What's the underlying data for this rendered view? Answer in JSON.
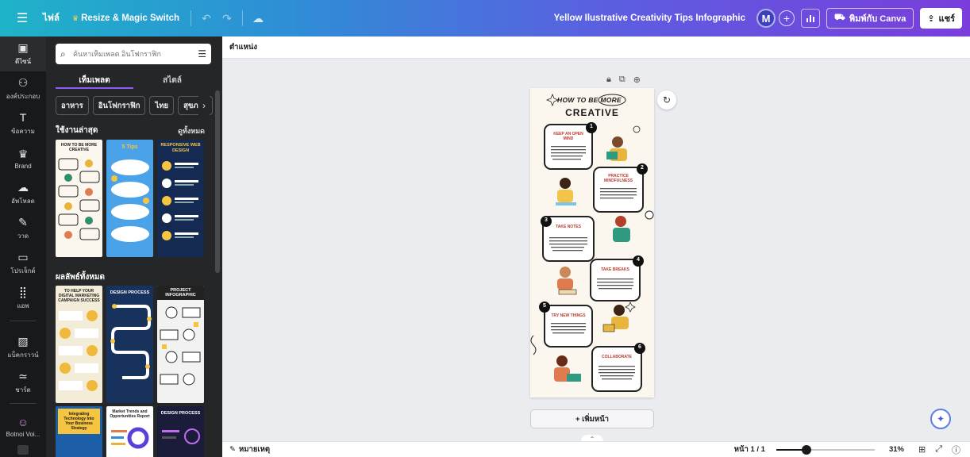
{
  "topbar": {
    "file_label": "ไฟล์",
    "resize_label": "Resize & Magic Switch",
    "doc_title": "Yellow Ilustrative Creativity Tips Infographic",
    "avatar_initial": "M",
    "print_label": "พิมพ์กับ Canva",
    "share_label": "แชร์",
    "icons": [
      "menu-icon",
      "crown-icon",
      "undo-icon",
      "redo-icon",
      "cloud-check-icon",
      "plus-icon",
      "bar-chart-icon",
      "truck-icon",
      "share-icon"
    ]
  },
  "rail": {
    "items": [
      {
        "label": "ดีไซน์",
        "icon": "layout-icon",
        "glyph": "▣"
      },
      {
        "label": "องค์ประกอบ",
        "icon": "shapes-icon",
        "glyph": "⚇"
      },
      {
        "label": "ข้อความ",
        "icon": "text-icon",
        "glyph": "T"
      },
      {
        "label": "Brand",
        "icon": "brand-icon",
        "glyph": "♛"
      },
      {
        "label": "อัพโหลด",
        "icon": "upload-icon",
        "glyph": "☁"
      },
      {
        "label": "วาด",
        "icon": "draw-icon",
        "glyph": "✎"
      },
      {
        "label": "โปรเจ็กต์",
        "icon": "folder-icon",
        "glyph": "▭"
      },
      {
        "label": "แอพ",
        "icon": "apps-icon",
        "glyph": "⣿"
      },
      {
        "label": "แบ็คกราวน์",
        "icon": "background-icon",
        "glyph": "▨"
      },
      {
        "label": "ชาร์ต",
        "icon": "chart-icon",
        "glyph": "≃"
      },
      {
        "label": "Botnoi Voi...",
        "icon": "botnoi-icon",
        "glyph": "☺"
      }
    ]
  },
  "panel": {
    "search_placeholder": "ค้นหาเท็มเพลต อินโฟกราฟิก",
    "tabs": [
      "เท็มเพลต",
      "สไตล์"
    ],
    "chips": [
      "อาหาร",
      "อินโฟกราฟิก",
      "ไทย",
      "สุขภาพ"
    ],
    "recent_title": "ใช้งานล่าสุด",
    "see_all": "ดูทั้งหมด",
    "all_results_title": "ผลลัพธ์ทั้งหมด",
    "recent_thumbs": [
      {
        "title": "HOW TO BE MORE CREATIVE",
        "bg": "#fbf7ee",
        "fg": "#1a1a1a"
      },
      {
        "title": "5 Tips",
        "bg": "#4aa3e8",
        "fg": "#ffffff"
      },
      {
        "title": "RESPONSIVE WEB DESIGN",
        "bg": "#152a52",
        "fg": "#f5c542"
      }
    ],
    "result_thumbs": [
      {
        "title": "TO HELP YOUR DIGITAL MARKETING CAMPAIGN SUCCESS",
        "bg": "#f3ecd8",
        "fg": "#1a1a1a"
      },
      {
        "title": "DESIGN PROCESS",
        "bg": "#17325c",
        "fg": "#ffffff"
      },
      {
        "title": "PROJECT INFOGRAPHIC",
        "bg": "#f2f2f2",
        "fg": "#1a1a1a"
      },
      {
        "title": "Integrating Technology Into Your Business Strategy",
        "bg": "#1c5fa8",
        "fg": "#f5c542"
      },
      {
        "title": "Market Trends and Opportunities Report",
        "bg": "#ffffff",
        "fg": "#1a1a1a"
      },
      {
        "title": "DESIGN PROCESS",
        "bg": "#1b1b3a",
        "fg": "#ffffff"
      }
    ]
  },
  "editor": {
    "position_label": "ตำแหน่ง",
    "add_page_label": "+ เพิ่มหน้า",
    "infographic": {
      "title_line1": "HOW TO BE MORE",
      "title_line2": "CREATIVE",
      "tips": [
        {
          "num": "1",
          "title": "KEEP AN OPEN MIND"
        },
        {
          "num": "2",
          "title": "PRACTICE MINDFULNESS"
        },
        {
          "num": "3",
          "title": "TAKE NOTES"
        },
        {
          "num": "4",
          "title": "TAKE BREAKS"
        },
        {
          "num": "5",
          "title": "TRY NEW THINGS"
        },
        {
          "num": "6",
          "title": "COLLABORATE"
        }
      ],
      "body": "Lorem ipsum dolor sit amet, consectetur adipiscing elit. Aliquam gravida elit pulvinar purus dapibus Congue. Nulla facilisi. Duis ullamcorper augue."
    }
  },
  "status": {
    "notes_label": "หมายเหตุ",
    "page_indicator": "หน้า 1 / 1",
    "zoom_pct": "31%",
    "zoom_fraction": 0.31
  },
  "colors": {
    "accent": "#8b5cf6",
    "rail_bg": "#18191b",
    "panel_bg": "#252627",
    "canvas_bg": "#ebecf0",
    "page_bg": "#fbf7ee"
  }
}
